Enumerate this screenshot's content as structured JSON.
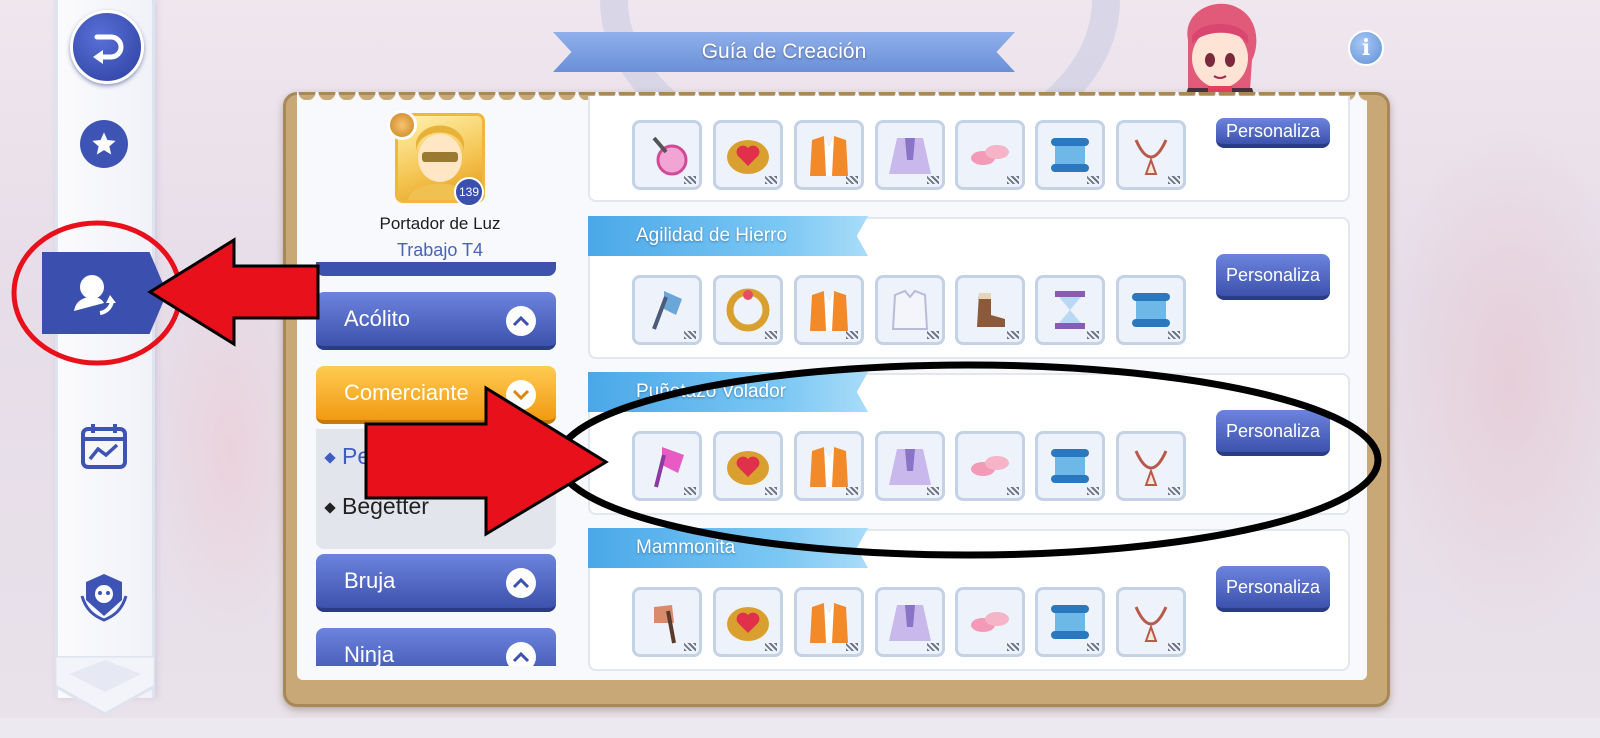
{
  "header": {
    "title": "Guía de Creación"
  },
  "character": {
    "name": "Portador de Luz",
    "job": "Trabajo T4",
    "level": "139"
  },
  "class_list": [
    {
      "label": "Acólito",
      "state": "collapsed"
    },
    {
      "label": "Comerciante",
      "state": "expanded"
    },
    {
      "label": "Bruja",
      "state": "collapsed"
    },
    {
      "label": "Ninja",
      "state": "collapsed"
    }
  ],
  "sub_items": [
    {
      "label": "Pe",
      "active": true
    },
    {
      "label": "Begetter",
      "active": false
    }
  ],
  "builds": [
    {
      "title": "",
      "button": "Personaliza",
      "items": [
        "magnifier-wand",
        "heart-ring",
        "orange-vest",
        "lavender-cape",
        "pink-shoes",
        "blue-scroll",
        "bone-necklace"
      ]
    },
    {
      "title": "Agilidad de Hierro",
      "button": "Personaliza",
      "items": [
        "blue-axe",
        "gold-bracelet",
        "orange-vest",
        "white-shirt",
        "brown-boots",
        "hourglass",
        "blue-scroll"
      ]
    },
    {
      "title": "Puñetazo Volador",
      "button": "Personaliza",
      "items": [
        "pink-axe",
        "heart-ring",
        "orange-vest",
        "lavender-cape",
        "pink-shoes",
        "blue-scroll",
        "bone-necklace"
      ]
    },
    {
      "title": "Mammonita",
      "button": "Personaliza",
      "items": [
        "bronze-axe",
        "heart-ring",
        "orange-vest",
        "lavender-cape",
        "pink-shoes",
        "blue-scroll",
        "bone-necklace"
      ]
    }
  ],
  "colors": {
    "primary_blue": "#3c52ad",
    "gold": "#f19a13",
    "annotation_red": "#e8101a"
  }
}
